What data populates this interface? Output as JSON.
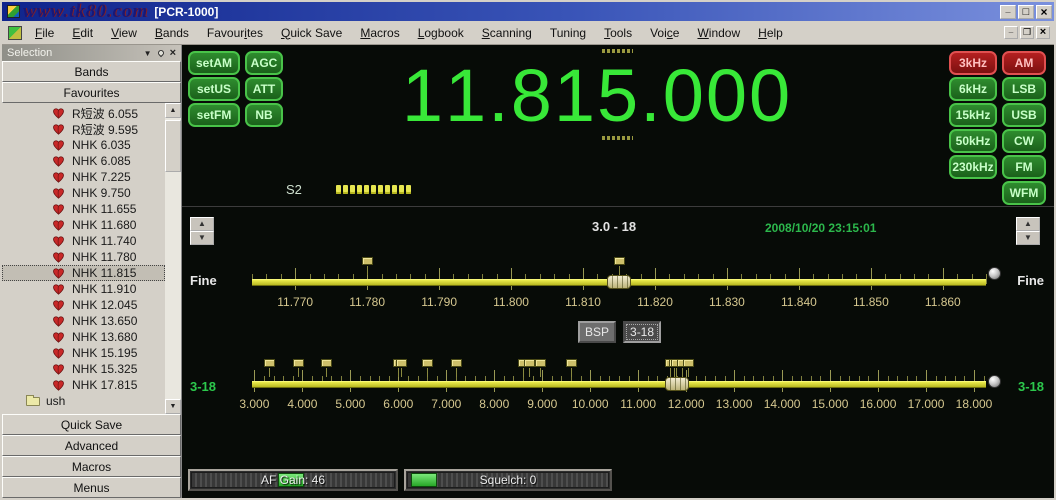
{
  "window": {
    "title": "[PCR-1000]",
    "watermark": "www.tk80.com"
  },
  "titlebar": {
    "buttons": [
      "minimize",
      "maximize",
      "close"
    ]
  },
  "menu": {
    "items": [
      {
        "label": "File",
        "u": 0
      },
      {
        "label": "Edit",
        "u": 0
      },
      {
        "label": "View",
        "u": 0
      },
      {
        "label": "Bands",
        "u": 0
      },
      {
        "label": "Favourites",
        "u": 6
      },
      {
        "label": "Quick Save",
        "u": 0
      },
      {
        "label": "Macros",
        "u": 0
      },
      {
        "label": "Logbook",
        "u": 0
      },
      {
        "label": "Scanning",
        "u": 0
      },
      {
        "label": "Tuning",
        "u": 5
      },
      {
        "label": "Tools",
        "u": 0
      },
      {
        "label": "Voice",
        "u": 3
      },
      {
        "label": "Window",
        "u": 0
      },
      {
        "label": "Help",
        "u": 0
      }
    ],
    "mdi_buttons": [
      "minimize",
      "restore",
      "close"
    ]
  },
  "sidebar": {
    "header": "Selection",
    "bands_label": "Bands",
    "favourites_label": "Favourites",
    "items": [
      {
        "label": "R短波 6.055"
      },
      {
        "label": "R短波 9.595"
      },
      {
        "label": "NHK 6.035"
      },
      {
        "label": "NHK 6.085"
      },
      {
        "label": "NHK 7.225"
      },
      {
        "label": "NHK 9.750"
      },
      {
        "label": "NHK 11.655"
      },
      {
        "label": "NHK 11.680"
      },
      {
        "label": "NHK 11.740"
      },
      {
        "label": "NHK 11.780"
      },
      {
        "label": "NHK 11.815",
        "selected": true
      },
      {
        "label": "NHK 11.910"
      },
      {
        "label": "NHK 12.045"
      },
      {
        "label": "NHK 13.650"
      },
      {
        "label": "NHK 13.680"
      },
      {
        "label": "NHK 15.195"
      },
      {
        "label": "NHK 15.325"
      },
      {
        "label": "NHK 17.815"
      },
      {
        "label": "ush",
        "folder": true
      }
    ],
    "bottom_buttons": [
      "Quick Save",
      "Advanced",
      "Macros",
      "Menus"
    ]
  },
  "receiver": {
    "frequency": "11.815.000",
    "tune_digit": 5,
    "set_rows": [
      [
        "setAM",
        "AGC"
      ],
      [
        "setUS",
        "ATT"
      ],
      [
        "setFM",
        "NB"
      ]
    ],
    "filters": [
      {
        "label": "3kHz",
        "active": true
      },
      {
        "label": "6kHz"
      },
      {
        "label": "15kHz"
      },
      {
        "label": "50kHz"
      },
      {
        "label": "230kHz"
      }
    ],
    "modes": [
      {
        "label": "AM",
        "active": true
      },
      {
        "label": "LSB"
      },
      {
        "label": "USB"
      },
      {
        "label": "CW"
      },
      {
        "label": "FM"
      },
      {
        "label": "WFM"
      }
    ],
    "smeter": {
      "label": "S2",
      "segments": 11
    }
  },
  "band": {
    "range_label": "3.0  - 18",
    "datetime": "2008/10/20 23:15:01",
    "mid_buttons": [
      {
        "label": "BSP"
      },
      {
        "label": "3-18",
        "pressed": true
      }
    ],
    "fine": {
      "left_label": "Fine",
      "right_label": "Fine",
      "min": 11.764,
      "max": 11.866,
      "minor_step": 0.002,
      "major_step": 0.01,
      "handle": 11.815,
      "markers": [
        11.78,
        11.815
      ],
      "scale": [
        {
          "v": 11.77,
          "label": "11.770"
        },
        {
          "v": 11.78,
          "label": "11.780"
        },
        {
          "v": 11.79,
          "label": "11.790"
        },
        {
          "v": 11.8,
          "label": "11.800"
        },
        {
          "v": 11.81,
          "label": "11.810"
        },
        {
          "v": 11.82,
          "label": "11.820"
        },
        {
          "v": 11.83,
          "label": "11.830"
        },
        {
          "v": 11.84,
          "label": "11.840"
        },
        {
          "v": 11.85,
          "label": "11.850"
        },
        {
          "v": 11.86,
          "label": "11.860"
        }
      ]
    },
    "coarse": {
      "left_label": "3-18",
      "right_label": "3-18",
      "min": 2.95,
      "max": 18.25,
      "minor_step": 0.2,
      "major_step": 1,
      "handle": 11.815,
      "markers": [
        3.3,
        3.9,
        4.5,
        6.0,
        6.06,
        6.6,
        7.2,
        8.6,
        8.72,
        8.95,
        9.6,
        11.655,
        11.74,
        11.78,
        11.91,
        12.045
      ],
      "scale": [
        {
          "v": 3,
          "label": "3.000"
        },
        {
          "v": 4,
          "label": "4.000"
        },
        {
          "v": 5,
          "label": "5.000"
        },
        {
          "v": 6,
          "label": "6.000"
        },
        {
          "v": 7,
          "label": "7.000"
        },
        {
          "v": 8,
          "label": "8.000"
        },
        {
          "v": 9,
          "label": "9.000"
        },
        {
          "v": 10,
          "label": "10.000"
        },
        {
          "v": 11,
          "label": "11.000"
        },
        {
          "v": 12,
          "label": "12.000"
        },
        {
          "v": 13,
          "label": "13.000"
        },
        {
          "v": 14,
          "label": "14.000"
        },
        {
          "v": 15,
          "label": "15.000"
        },
        {
          "v": 16,
          "label": "16.000"
        },
        {
          "v": 17,
          "label": "17.000"
        },
        {
          "v": 18,
          "label": "18.000"
        }
      ]
    }
  },
  "audio": {
    "af_gain": {
      "label": "AF Gain: 46",
      "handle_pct": 49
    },
    "squelch": {
      "label": "Squelch: 0",
      "handle_pct": 8
    }
  },
  "colors": {
    "accent_green": "#38e838",
    "active_red": "#b42020",
    "slider_yellow": "#d8d838",
    "datetime_green": "#2cb84c"
  }
}
